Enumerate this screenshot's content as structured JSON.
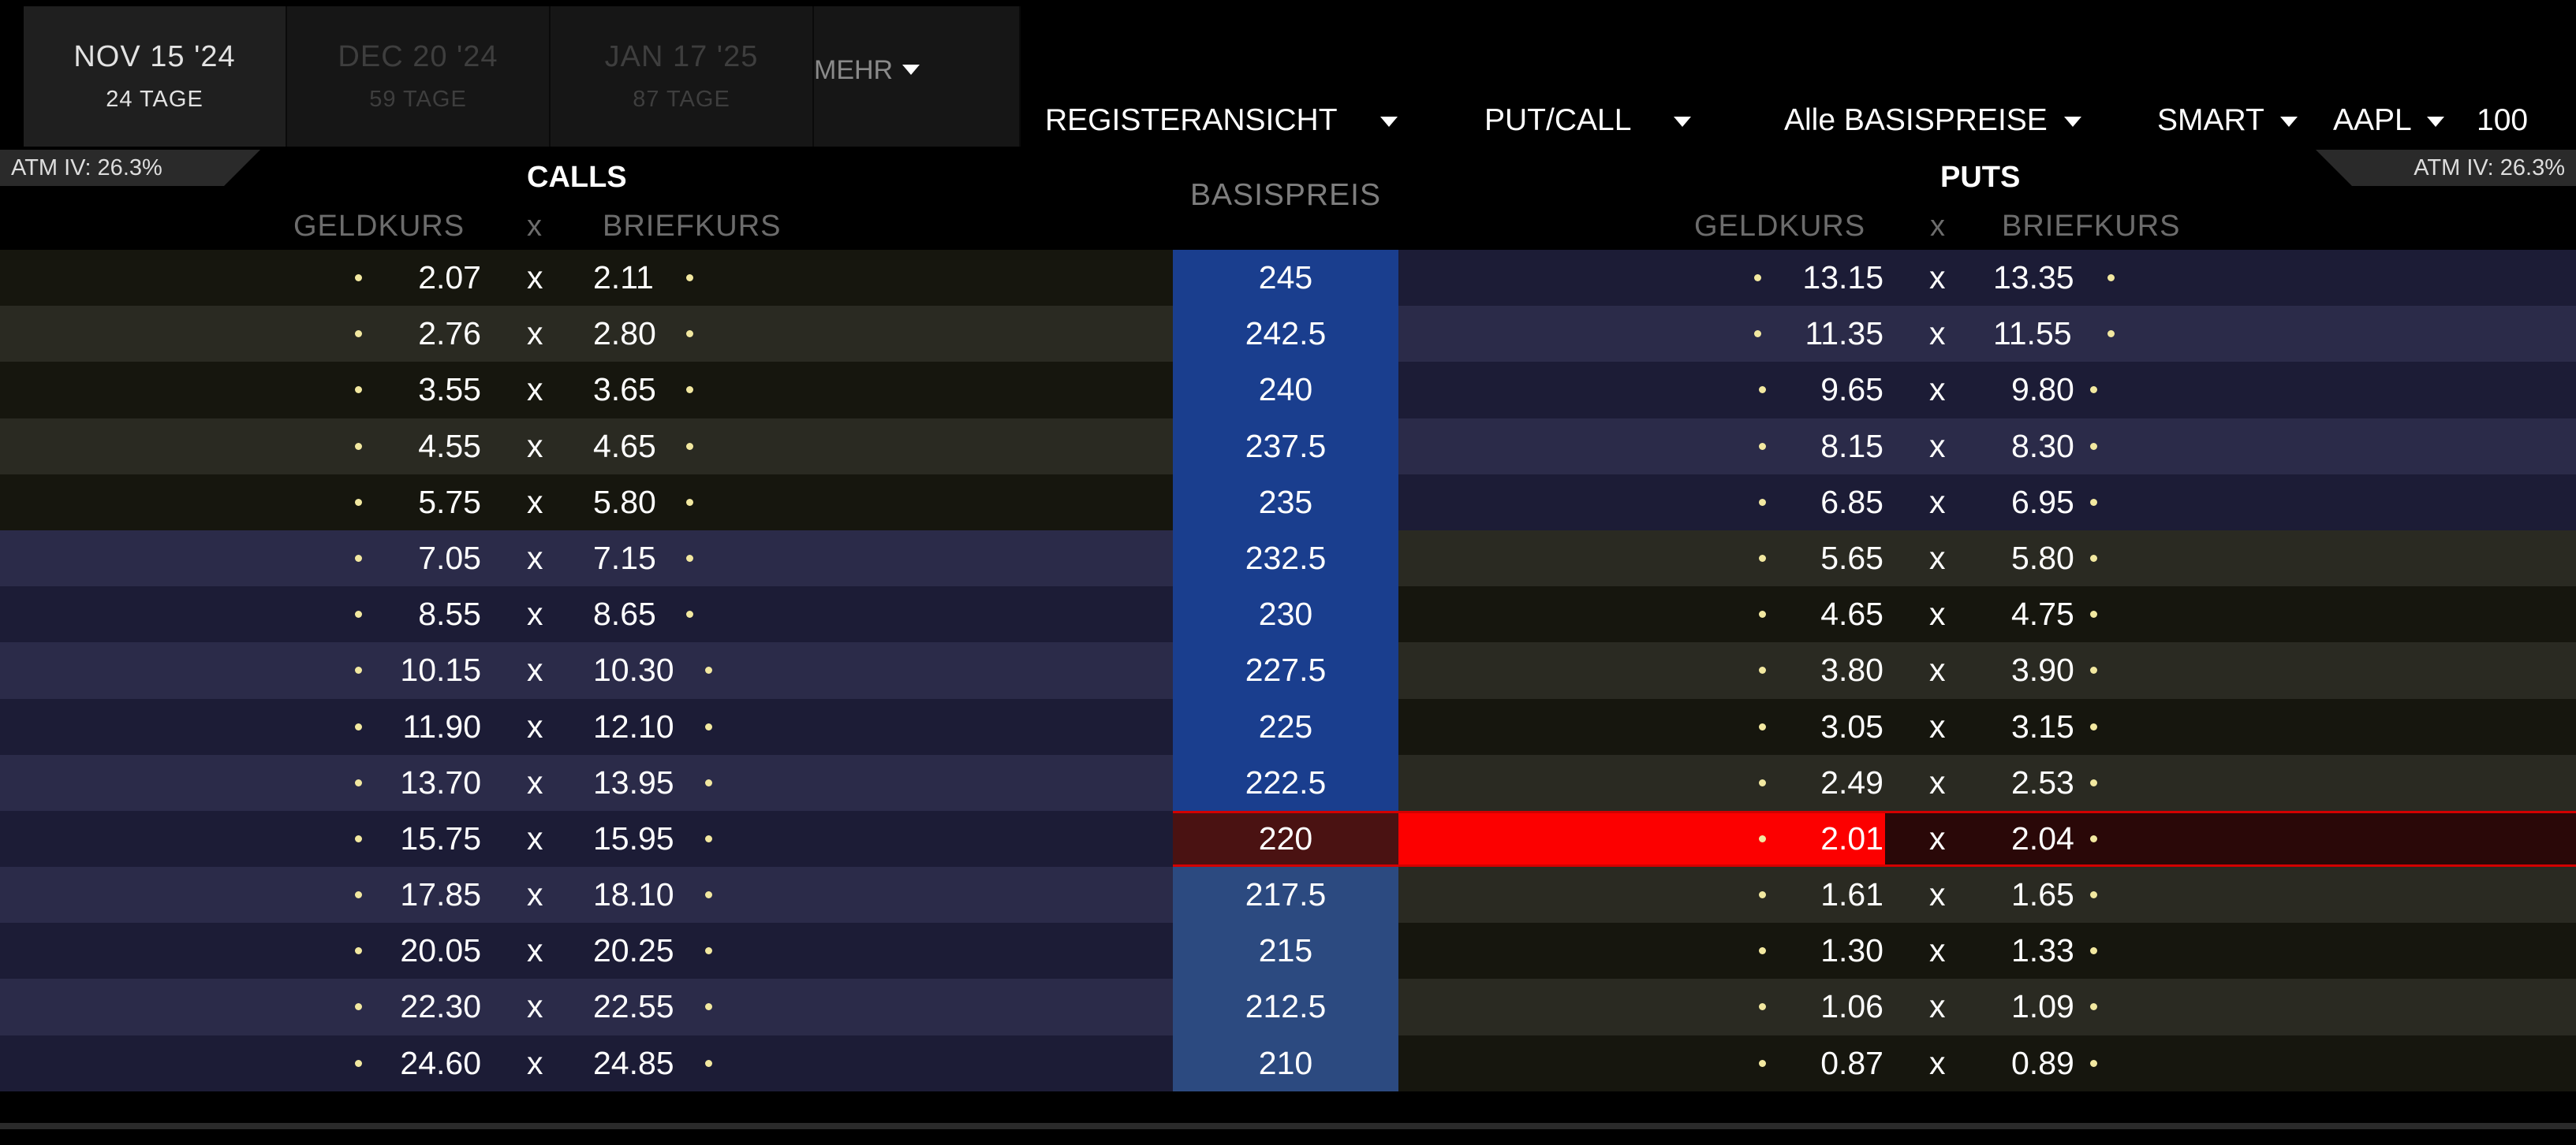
{
  "tabs": [
    {
      "date": "NOV 15 '24",
      "days": "24 TAGE",
      "active": true
    },
    {
      "date": "DEC 20 '24",
      "days": "59 TAGE",
      "active": false
    },
    {
      "date": "JAN 17 '25",
      "days": "87 TAGE",
      "active": false
    }
  ],
  "more_label": "MEHR",
  "toolbar": {
    "view": "REGISTERANSICHT",
    "putcall": "PUT/CALL",
    "strikes": "Alle BASISPREISE",
    "exchange": "SMART",
    "symbol": "AAPL",
    "quantity": "100"
  },
  "header": {
    "atm_left": "ATM IV: 26.3%",
    "atm_right": "ATM IV: 26.3%",
    "calls": "CALLS",
    "puts": "PUTS",
    "bid": "GELDKURS",
    "ask": "BRIEFKURS",
    "x": "x",
    "strike": "BASISPREIS"
  },
  "colors": {
    "call_otm_a": "#16160e",
    "call_otm_b": "#2a2a22",
    "call_itm_a": "#1c1c36",
    "call_itm_b": "#2b2b49",
    "strike_upper": "#1a3e8e",
    "strike_lower": "#2c4a80",
    "strike_atm": "#4a1212",
    "atm_red": "#fc0000",
    "atm_bg": "#2a0808"
  },
  "rows": [
    {
      "strike": "245",
      "call_bid": "2.07",
      "call_ask": "2.11",
      "put_bid": "13.15",
      "put_ask": "13.35"
    },
    {
      "strike": "242.5",
      "call_bid": "2.76",
      "call_ask": "2.80",
      "put_bid": "11.35",
      "put_ask": "11.55"
    },
    {
      "strike": "240",
      "call_bid": "3.55",
      "call_ask": "3.65",
      "put_bid": "9.65",
      "put_ask": "9.80"
    },
    {
      "strike": "237.5",
      "call_bid": "4.55",
      "call_ask": "4.65",
      "put_bid": "8.15",
      "put_ask": "8.30"
    },
    {
      "strike": "235",
      "call_bid": "5.75",
      "call_ask": "5.80",
      "put_bid": "6.85",
      "put_ask": "6.95"
    },
    {
      "strike": "232.5",
      "call_bid": "7.05",
      "call_ask": "7.15",
      "put_bid": "5.65",
      "put_ask": "5.80"
    },
    {
      "strike": "230",
      "call_bid": "8.55",
      "call_ask": "8.65",
      "put_bid": "4.65",
      "put_ask": "4.75"
    },
    {
      "strike": "227.5",
      "call_bid": "10.15",
      "call_ask": "10.30",
      "put_bid": "3.80",
      "put_ask": "3.90"
    },
    {
      "strike": "225",
      "call_bid": "11.90",
      "call_ask": "12.10",
      "put_bid": "3.05",
      "put_ask": "3.15"
    },
    {
      "strike": "222.5",
      "call_bid": "13.70",
      "call_ask": "13.95",
      "put_bid": "2.49",
      "put_ask": "2.53"
    },
    {
      "strike": "220",
      "call_bid": "15.75",
      "call_ask": "15.95",
      "put_bid": "2.01",
      "put_ask": "2.04",
      "atm": true
    },
    {
      "strike": "217.5",
      "call_bid": "17.85",
      "call_ask": "18.10",
      "put_bid": "1.61",
      "put_ask": "1.65"
    },
    {
      "strike": "215",
      "call_bid": "20.05",
      "call_ask": "20.25",
      "put_bid": "1.30",
      "put_ask": "1.33"
    },
    {
      "strike": "212.5",
      "call_bid": "22.30",
      "call_ask": "22.55",
      "put_bid": "1.06",
      "put_ask": "1.09"
    },
    {
      "strike": "210",
      "call_bid": "24.60",
      "call_ask": "24.85",
      "put_bid": "0.87",
      "put_ask": "0.89"
    }
  ]
}
